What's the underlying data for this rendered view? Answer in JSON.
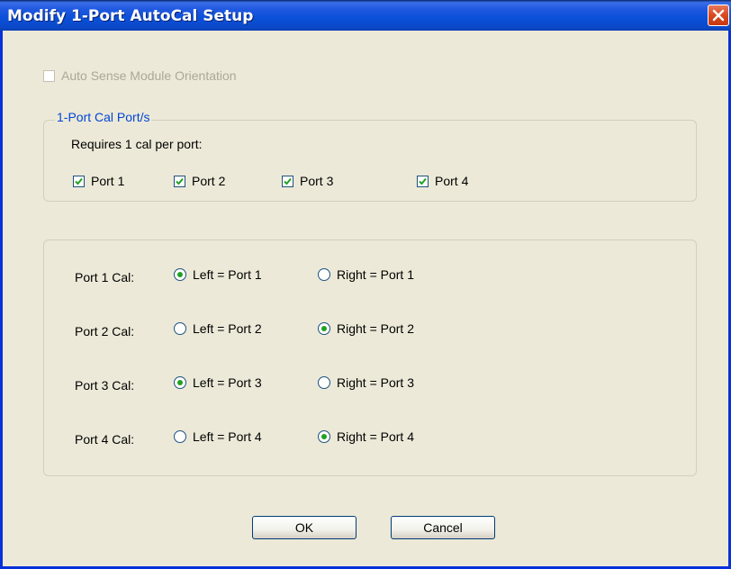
{
  "window": {
    "title": "Modify 1-Port AutoCal Setup",
    "close_icon": "close-icon"
  },
  "auto_sense": {
    "label": "Auto Sense Module Orientation",
    "checked": false,
    "enabled": false
  },
  "cal_ports_group": {
    "legend": "1-Port Cal Port/s",
    "note": "Requires 1 cal per port:",
    "ports": [
      {
        "label": "Port 1",
        "checked": true
      },
      {
        "label": "Port 2",
        "checked": true
      },
      {
        "label": "Port 3",
        "checked": true
      },
      {
        "label": "Port 4",
        "checked": true
      }
    ]
  },
  "orientation_group": {
    "rows": [
      {
        "label": "Port 1 Cal:",
        "left_label": "Left = Port 1",
        "right_label": "Right = Port 1",
        "selected": "left"
      },
      {
        "label": "Port 2 Cal:",
        "left_label": "Left = Port 2",
        "right_label": "Right = Port 2",
        "selected": "right"
      },
      {
        "label": "Port 3 Cal:",
        "left_label": "Left = Port 3",
        "right_label": "Right = Port 3",
        "selected": "left"
      },
      {
        "label": "Port 4 Cal:",
        "left_label": "Left = Port 4",
        "right_label": "Right = Port 4",
        "selected": "right"
      }
    ]
  },
  "buttons": {
    "ok": "OK",
    "cancel": "Cancel"
  }
}
